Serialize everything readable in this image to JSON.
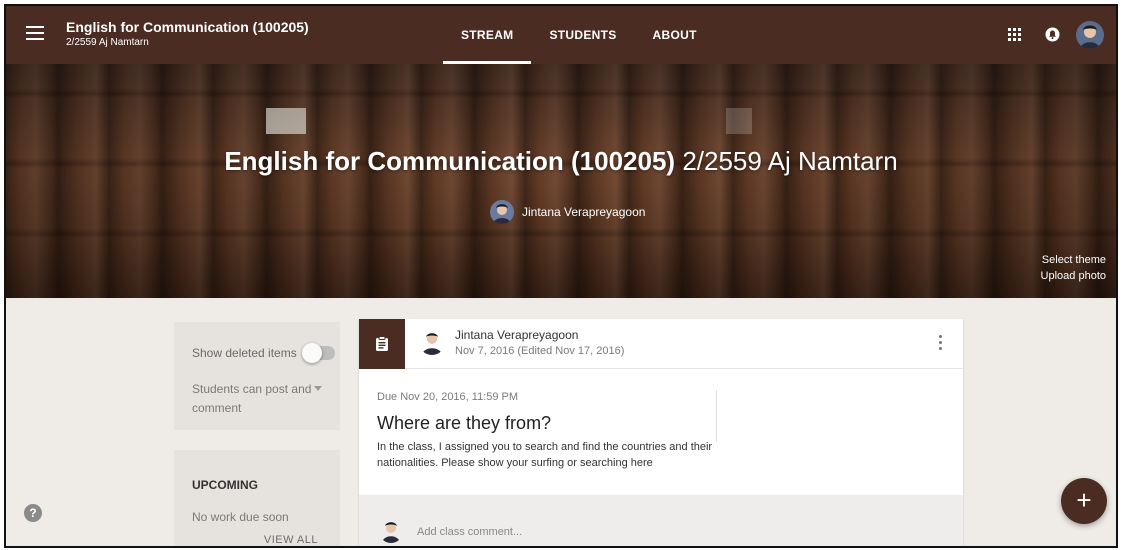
{
  "topbar": {
    "class_title": "English for Communication (100205)",
    "class_subtitle": "2/2559 Aj Namtarn",
    "tabs": [
      {
        "label": "STREAM",
        "active": true
      },
      {
        "label": "STUDENTS",
        "active": false
      },
      {
        "label": "ABOUT",
        "active": false
      }
    ],
    "icons": [
      "menu-icon",
      "apps-grid-icon",
      "notification-icon",
      "profile-avatar"
    ]
  },
  "banner": {
    "title_bold": "English for Communication (100205)",
    "title_rest": "2/2559 Aj Namtarn",
    "teacher_name": "Jintana Verapreyagoon",
    "select_theme": "Select theme",
    "upload_photo": "Upload photo"
  },
  "sidebar": {
    "show_deleted_label": "Show deleted items",
    "show_deleted_on": false,
    "permission_value": "Students can post and comment",
    "upcoming_heading": "UPCOMING",
    "upcoming_text": "No work due soon",
    "view_all": "VIEW ALL"
  },
  "post": {
    "type_icon": "assignment-icon",
    "author": "Jintana Verapreyagoon",
    "date": "Nov 7, 2016 (Edited Nov 17, 2016)",
    "due": "Due Nov 20, 2016, 11:59 PM",
    "title": "Where are they from?",
    "description": "In the class, I assigned you to search and find the countries and their nationalities. Please show your surfing or searching here",
    "comment_placeholder": "Add class comment..."
  },
  "fab_label": "+",
  "help_label": "?",
  "colors": {
    "theme": "#4a2c22",
    "page_bg": "#efece8",
    "sidebar_card": "#e6e3df"
  }
}
